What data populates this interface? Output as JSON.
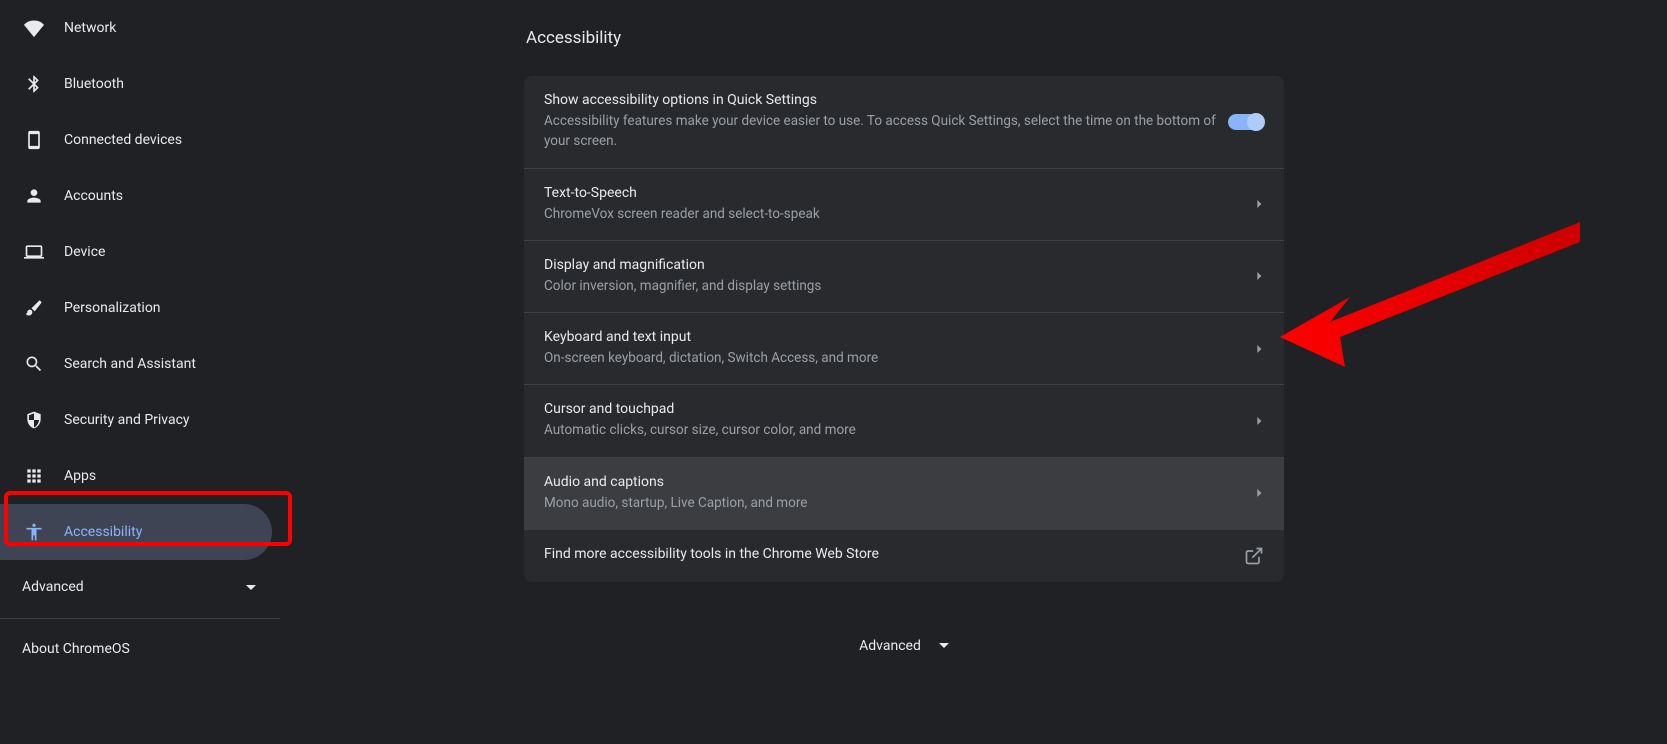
{
  "sidebar": {
    "items": [
      {
        "label": "Network",
        "icon": "wifi"
      },
      {
        "label": "Bluetooth",
        "icon": "bluetooth"
      },
      {
        "label": "Connected devices",
        "icon": "phone"
      },
      {
        "label": "Accounts",
        "icon": "person"
      },
      {
        "label": "Device",
        "icon": "laptop"
      },
      {
        "label": "Personalization",
        "icon": "brush"
      },
      {
        "label": "Search and Assistant",
        "icon": "search"
      },
      {
        "label": "Security and Privacy",
        "icon": "shield"
      },
      {
        "label": "Apps",
        "icon": "apps"
      },
      {
        "label": "Accessibility",
        "icon": "accessibility",
        "selected": true
      }
    ],
    "advanced": "Advanced",
    "about": "About ChromeOS"
  },
  "page": {
    "title": "Accessibility"
  },
  "settings": [
    {
      "title": "Show accessibility options in Quick Settings",
      "subtitle": "Accessibility features make your device easier to use. To access Quick Settings, select the time on the bottom of your screen.",
      "action": "toggle",
      "toggled": true
    },
    {
      "title": "Text-to-Speech",
      "subtitle": "ChromeVox screen reader and select-to-speak",
      "action": "chevron"
    },
    {
      "title": "Display and magnification",
      "subtitle": "Color inversion, magnifier, and display settings",
      "action": "chevron"
    },
    {
      "title": "Keyboard and text input",
      "subtitle": "On-screen keyboard, dictation, Switch Access, and more",
      "action": "chevron"
    },
    {
      "title": "Cursor and touchpad",
      "subtitle": "Automatic clicks, cursor size, cursor color, and more",
      "action": "chevron"
    },
    {
      "title": "Audio and captions",
      "subtitle": "Mono audio, startup, Live Caption, and more",
      "action": "chevron",
      "hovered": true
    },
    {
      "title": "Find more accessibility tools in the Chrome Web Store",
      "subtitle": "",
      "action": "external"
    }
  ],
  "advanced_bottom": "Advanced"
}
